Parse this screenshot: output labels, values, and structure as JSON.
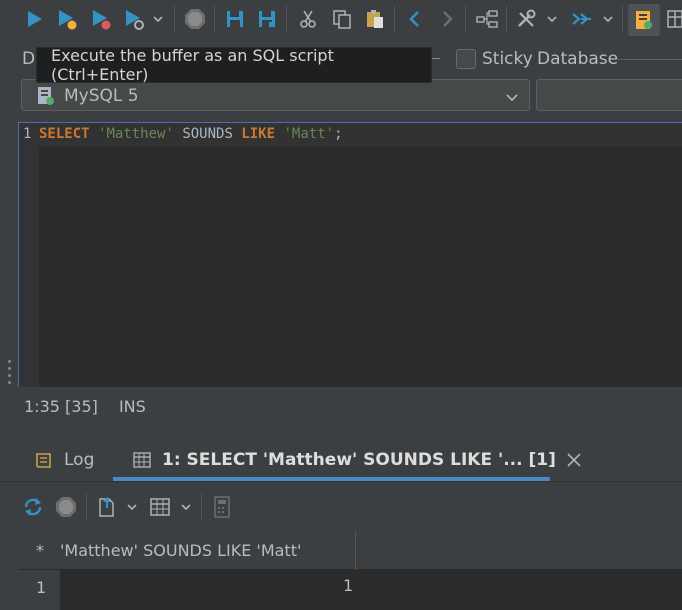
{
  "toolbar": {
    "icons": [
      "execute-icon",
      "execute-selection-icon",
      "execute-script-icon",
      "explain-plan-icon",
      "dropdown-icon",
      "stop-icon",
      "save-icon",
      "save-as-icon",
      "cut-icon",
      "copy-icon",
      "paste-icon",
      "back-icon",
      "forward-icon",
      "diagram-icon",
      "tools-icon",
      "dropdown-icon",
      "transfer-icon",
      "dropdown-icon",
      "sql-pinned-icon",
      "layout-icon"
    ]
  },
  "tooltip": {
    "text": "Execute the buffer as an SQL script (Ctrl+Enter)"
  },
  "connection": {
    "label_fragment": "D",
    "sticky_label": "Sticky",
    "database_label": "Database",
    "dialect": "MySQL 5"
  },
  "editor": {
    "line_number": "1",
    "tokens": {
      "kw_select": "SELECT",
      "str_1": "'Matthew'",
      "word_sounds": "SOUNDS",
      "kw_like": "LIKE",
      "str_2": "'Matt'",
      "semicolon": ";"
    }
  },
  "status": {
    "position": "1:35 [35]",
    "mode": "INS"
  },
  "tabs": [
    {
      "label": "Log"
    },
    {
      "label": "1: SELECT 'Matthew' SOUNDS LIKE '... [1]"
    }
  ],
  "grid": {
    "header_marker": "*",
    "column_header": "'Matthew' SOUNDS LIKE 'Matt'",
    "rows": [
      {
        "row_number": "1",
        "value": "1"
      }
    ]
  },
  "colors": {
    "accent": "#4a88c7",
    "keyword": "#cc7832",
    "string": "#6a8759",
    "execute_blue": "#3592c4",
    "stop_red": "#db5c5c",
    "yellow": "#f4af3d"
  }
}
